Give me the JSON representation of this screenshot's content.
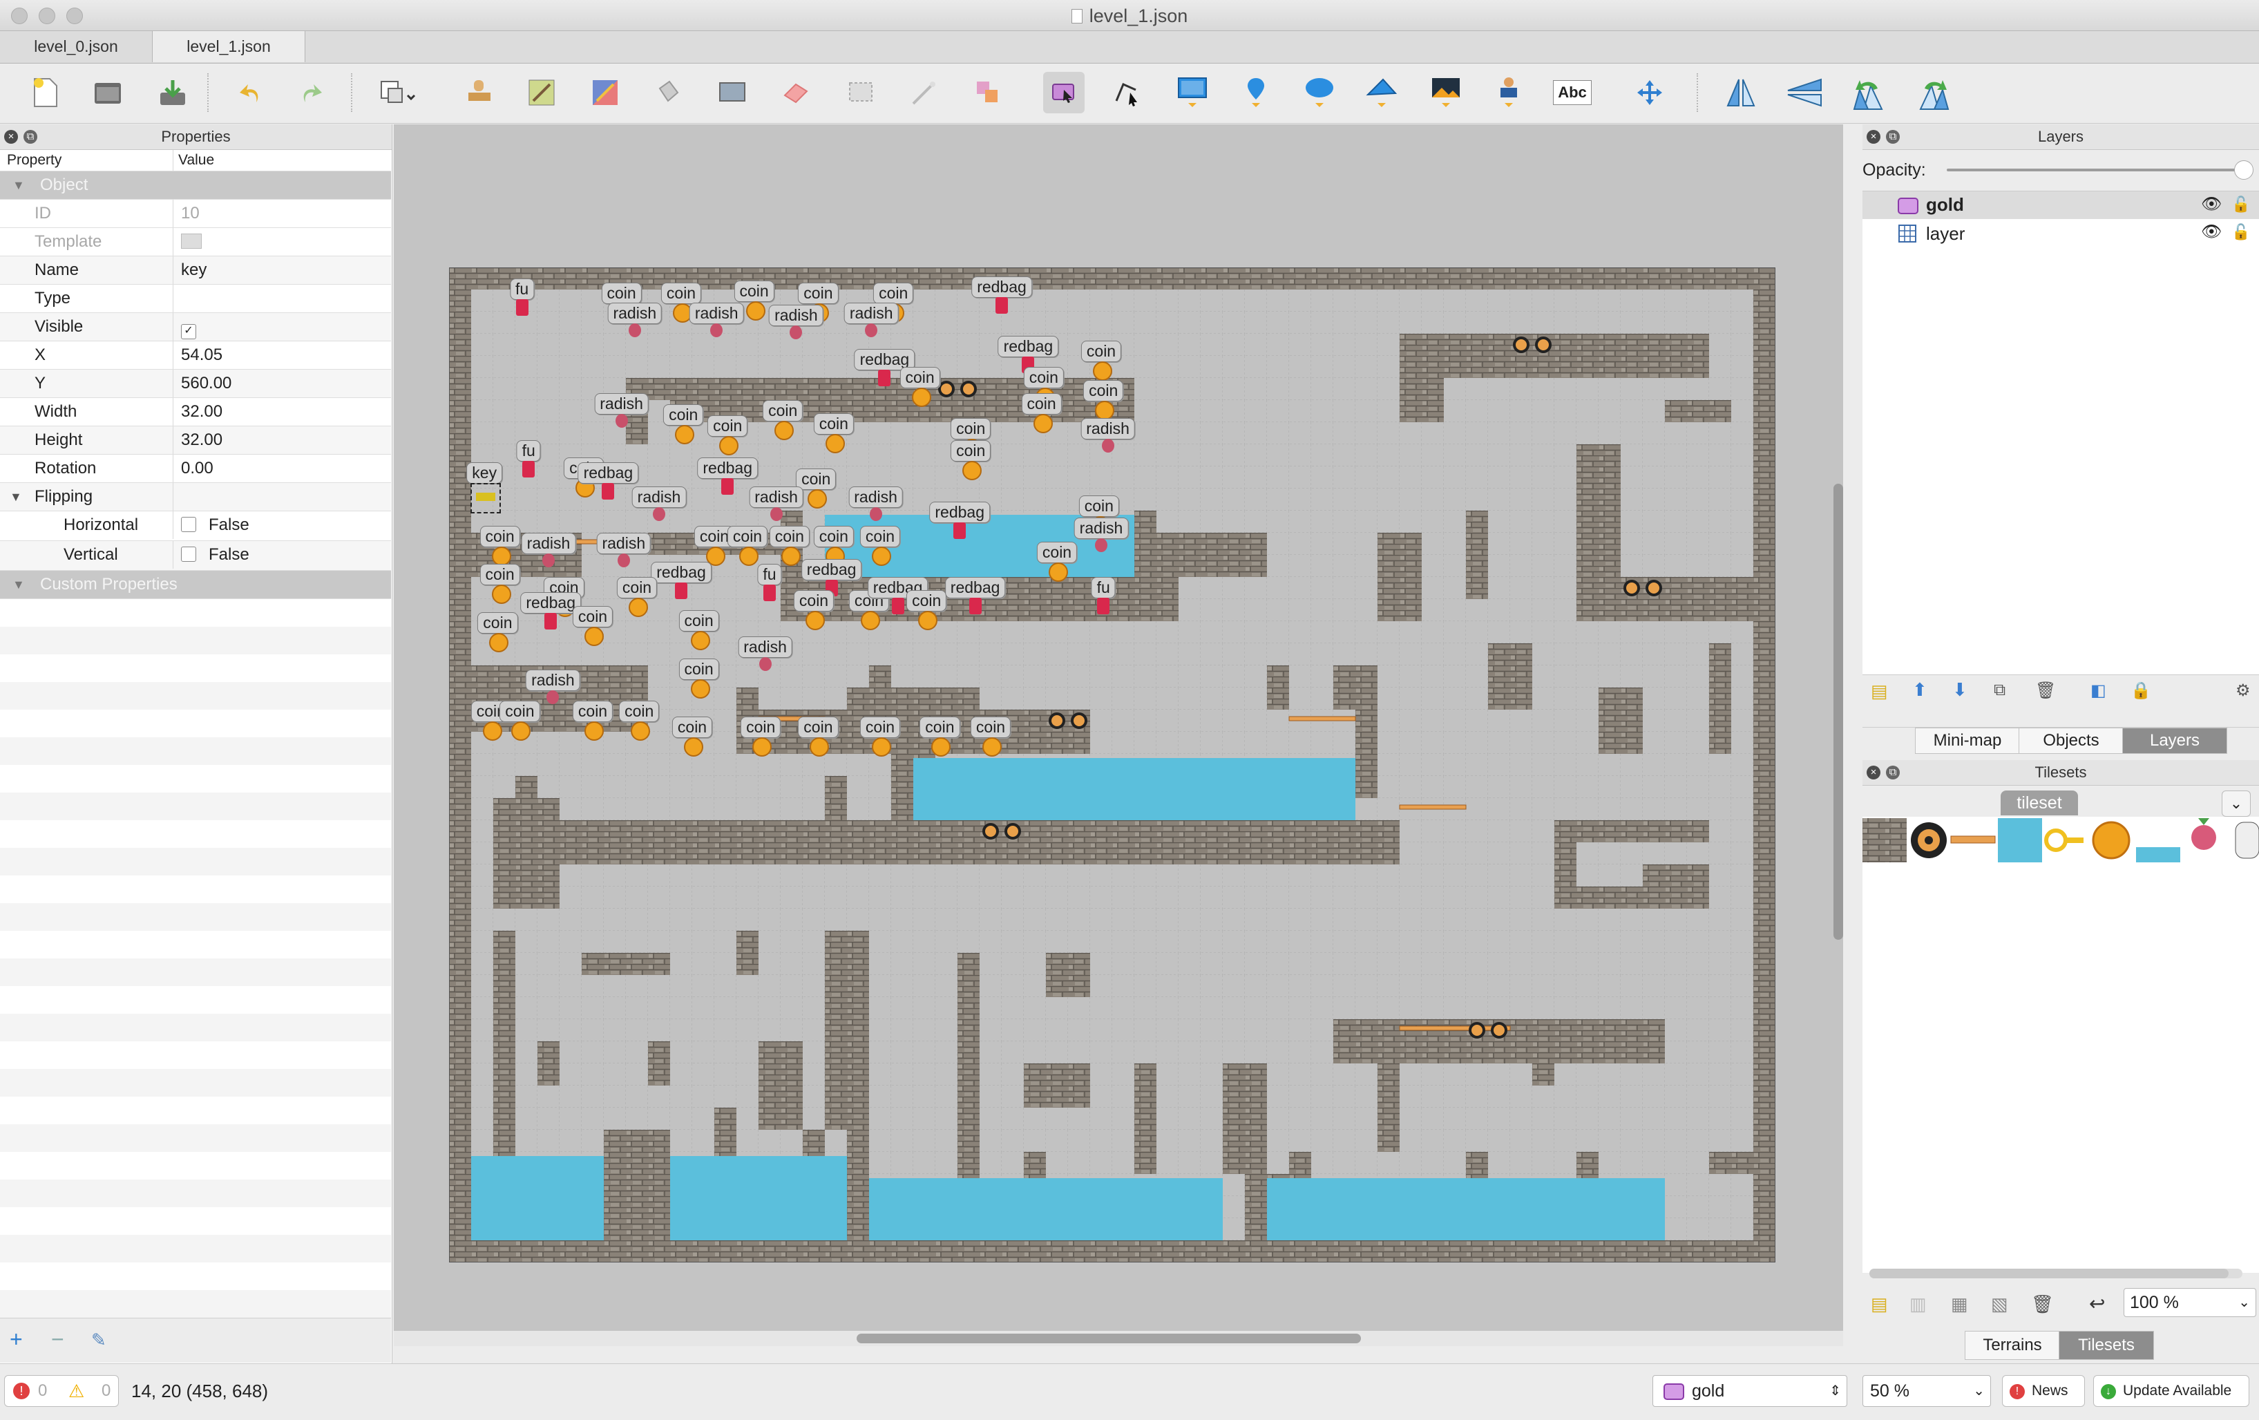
{
  "window": {
    "title": "level_1.json"
  },
  "tabs": [
    {
      "label": "level_0.json"
    },
    {
      "label": "level_1.json"
    }
  ],
  "toolbar": {
    "tools": [
      "new-map",
      "open-file",
      "save-file",
      "undo",
      "redo",
      "stamp-tool-options",
      "stamp-brush",
      "terrain-brush",
      "wang-brush",
      "bucket-fill",
      "shape-fill",
      "eraser",
      "rectangular-select",
      "magic-wand",
      "select-same-tile",
      "select-objects",
      "edit-polygons",
      "insert-rectangle",
      "insert-point",
      "insert-ellipse",
      "insert-polygon",
      "insert-tile",
      "insert-template",
      "insert-text",
      "move-layer",
      "flip-horizontal",
      "flip-vertical",
      "rotate-left",
      "rotate-right"
    ],
    "text_tool_label": "Abc"
  },
  "properties": {
    "title": "Properties",
    "col_property": "Property",
    "col_value": "Value",
    "group_object": "Object",
    "rows": [
      {
        "key": "ID",
        "value": "10"
      },
      {
        "key": "Template",
        "value": ""
      },
      {
        "key": "Name",
        "value": "key"
      },
      {
        "key": "Type",
        "value": ""
      },
      {
        "key": "Visible",
        "value": ""
      },
      {
        "key": "X",
        "value": "54.05"
      },
      {
        "key": "Y",
        "value": "560.00"
      },
      {
        "key": "Width",
        "value": "32.00"
      },
      {
        "key": "Height",
        "value": "32.00"
      },
      {
        "key": "Rotation",
        "value": "0.00"
      }
    ],
    "group_flipping": "Flipping",
    "horizontal_label": "Horizontal",
    "horizontal_value": "False",
    "vertical_label": "Vertical",
    "vertical_value": "False",
    "group_custom": "Custom Properties"
  },
  "map_objects": [
    {
      "name": "fu",
      "col": 2.8,
      "row": 0.5
    },
    {
      "name": "coin",
      "col": 7.3,
      "row": 0.7
    },
    {
      "name": "coin",
      "col": 10.0,
      "row": 0.7
    },
    {
      "name": "coin",
      "col": 13.3,
      "row": 0.6
    },
    {
      "name": "coin",
      "col": 16.2,
      "row": 0.7
    },
    {
      "name": "coin",
      "col": 19.6,
      "row": 0.7
    },
    {
      "name": "redbag",
      "col": 24.5,
      "row": 0.4
    },
    {
      "name": "radish",
      "col": 7.9,
      "row": 1.6
    },
    {
      "name": "radish",
      "col": 11.6,
      "row": 1.6
    },
    {
      "name": "radish",
      "col": 15.2,
      "row": 1.7
    },
    {
      "name": "radish",
      "col": 18.6,
      "row": 1.6
    },
    {
      "name": "redbag",
      "col": 25.7,
      "row": 3.1
    },
    {
      "name": "redbag",
      "col": 19.2,
      "row": 3.7
    },
    {
      "name": "coin",
      "col": 20.8,
      "row": 4.5
    },
    {
      "name": "coin",
      "col": 29.0,
      "row": 3.3
    },
    {
      "name": "coin",
      "col": 26.4,
      "row": 4.5
    },
    {
      "name": "coin",
      "col": 29.1,
      "row": 5.1
    },
    {
      "name": "coin",
      "col": 26.3,
      "row": 5.7
    },
    {
      "name": "radish",
      "col": 7.3,
      "row": 5.7
    },
    {
      "name": "coin",
      "col": 10.1,
      "row": 6.2
    },
    {
      "name": "coin",
      "col": 12.1,
      "row": 6.7
    },
    {
      "name": "coin",
      "col": 14.6,
      "row": 6.0
    },
    {
      "name": "coin",
      "col": 16.9,
      "row": 6.6
    },
    {
      "name": "coin",
      "col": 23.1,
      "row": 6.8
    },
    {
      "name": "coin",
      "col": 23.1,
      "row": 7.8
    },
    {
      "name": "radish",
      "col": 29.3,
      "row": 6.8
    },
    {
      "name": "fu",
      "col": 3.1,
      "row": 7.8
    },
    {
      "name": "coin",
      "col": 5.6,
      "row": 8.6
    },
    {
      "name": "redbag",
      "col": 6.7,
      "row": 8.8
    },
    {
      "name": "redbag",
      "col": 12.1,
      "row": 8.6
    },
    {
      "name": "coin",
      "col": 16.1,
      "row": 9.1
    },
    {
      "name": "key",
      "col": 1.1,
      "row": 8.8
    },
    {
      "name": "radish",
      "col": 9.0,
      "row": 9.9
    },
    {
      "name": "radish",
      "col": 14.3,
      "row": 9.9
    },
    {
      "name": "radish",
      "col": 18.8,
      "row": 9.9
    },
    {
      "name": "redbag",
      "col": 22.6,
      "row": 10.6
    },
    {
      "name": "coin",
      "col": 28.9,
      "row": 10.3
    },
    {
      "name": "coin",
      "col": 1.8,
      "row": 11.7
    },
    {
      "name": "radish",
      "col": 4.0,
      "row": 12.0
    },
    {
      "name": "radish",
      "col": 7.4,
      "row": 12.0
    },
    {
      "name": "coin",
      "col": 11.5,
      "row": 11.7
    },
    {
      "name": "coin",
      "col": 13.0,
      "row": 11.7
    },
    {
      "name": "coin",
      "col": 14.9,
      "row": 11.7
    },
    {
      "name": "coin",
      "col": 16.9,
      "row": 11.7
    },
    {
      "name": "coin",
      "col": 19.0,
      "row": 11.7
    },
    {
      "name": "radish",
      "col": 29.0,
      "row": 11.3
    },
    {
      "name": "coin",
      "col": 27.0,
      "row": 12.4
    },
    {
      "name": "coin",
      "col": 1.8,
      "row": 13.4
    },
    {
      "name": "redbag",
      "col": 10.0,
      "row": 13.3
    },
    {
      "name": "fu",
      "col": 14.0,
      "row": 13.4
    },
    {
      "name": "redbag",
      "col": 16.8,
      "row": 13.2
    },
    {
      "name": "coin",
      "col": 4.7,
      "row": 14.0
    },
    {
      "name": "coin",
      "col": 8.0,
      "row": 14.0
    },
    {
      "name": "redbag",
      "col": 4.1,
      "row": 14.7
    },
    {
      "name": "coin",
      "col": 6.0,
      "row": 15.3
    },
    {
      "name": "coin",
      "col": 16.0,
      "row": 14.6
    },
    {
      "name": "coin",
      "col": 18.5,
      "row": 14.6
    },
    {
      "name": "redbag",
      "col": 19.8,
      "row": 14.0
    },
    {
      "name": "coin",
      "col": 21.1,
      "row": 14.6
    },
    {
      "name": "redbag",
      "col": 23.3,
      "row": 14.0
    },
    {
      "name": "fu",
      "col": 29.1,
      "row": 14.0
    },
    {
      "name": "coin",
      "col": 1.7,
      "row": 15.6
    },
    {
      "name": "coin",
      "col": 10.8,
      "row": 15.5
    },
    {
      "name": "radish",
      "col": 13.8,
      "row": 16.7
    },
    {
      "name": "coin",
      "col": 10.8,
      "row": 17.7
    },
    {
      "name": "radish",
      "col": 4.2,
      "row": 18.2
    },
    {
      "name": "coin",
      "col": 1.4,
      "row": 19.6
    },
    {
      "name": "coin",
      "col": 2.7,
      "row": 19.6
    },
    {
      "name": "coin",
      "col": 6.0,
      "row": 19.6
    },
    {
      "name": "coin",
      "col": 8.1,
      "row": 19.6
    },
    {
      "name": "coin",
      "col": 10.5,
      "row": 20.3
    },
    {
      "name": "coin",
      "col": 13.6,
      "row": 20.3
    },
    {
      "name": "coin",
      "col": 16.2,
      "row": 20.3
    },
    {
      "name": "coin",
      "col": 19.0,
      "row": 20.3
    },
    {
      "name": "coin",
      "col": 21.7,
      "row": 20.3
    },
    {
      "name": "coin",
      "col": 24.0,
      "row": 20.3
    }
  ],
  "layers": {
    "title": "Layers",
    "opacity_label": "Opacity:",
    "opacity_value": 1.0,
    "items": [
      {
        "name": "gold",
        "icon": "object-layer-icon"
      },
      {
        "name": "layer",
        "icon": "tile-layer-icon"
      }
    ],
    "tabs": [
      "Mini-map",
      "Objects",
      "Layers"
    ],
    "active_tab": "Layers"
  },
  "tilesets": {
    "title": "Tilesets",
    "tab": "tileset",
    "zoom": "100 %",
    "bottom_tabs": [
      "Terrains",
      "Tilesets"
    ],
    "active_bottom_tab": "Tilesets"
  },
  "status": {
    "errors": "0",
    "warnings": "0",
    "position": "14, 20 (458, 648)",
    "layer_combo": "gold",
    "zoom": "50 %",
    "news": "News",
    "update": "Update Available"
  },
  "colors": {
    "brick": "#8a8278",
    "floor": "#c2c2c2",
    "water": "#5bbfdc",
    "coin": "#f0a21e",
    "redbag": "#d9284c",
    "accent_layer": "#b34bd1"
  }
}
